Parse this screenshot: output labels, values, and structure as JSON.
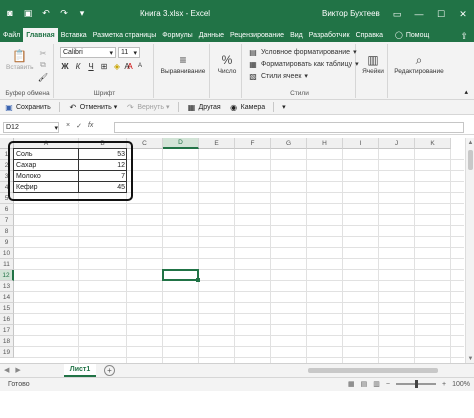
{
  "titlebar": {
    "title": "Книга 3.xlsx  -  Excel",
    "user": "Виктор Бухтеев"
  },
  "tabs": [
    {
      "label": "Файл",
      "active": false
    },
    {
      "label": "Главная",
      "active": true
    },
    {
      "label": "Вставка",
      "active": false
    },
    {
      "label": "Разметка страницы",
      "active": false
    },
    {
      "label": "Формулы",
      "active": false
    },
    {
      "label": "Данные",
      "active": false
    },
    {
      "label": "Рецензирование",
      "active": false
    },
    {
      "label": "Вид",
      "active": false
    },
    {
      "label": "Разработчик",
      "active": false
    },
    {
      "label": "Справка",
      "active": false
    }
  ],
  "search_tab": "Помощ",
  "ribbon": {
    "clipboard": {
      "paste": "Вставить",
      "label": "Буфер обмена"
    },
    "font": {
      "name": "Calibri",
      "size": "11",
      "label": "Шрифт"
    },
    "alignment": {
      "label": "Выравнивание"
    },
    "number": {
      "label": "Число"
    },
    "styles": {
      "conditional": "Условное форматирование",
      "as_table": "Форматировать как таблицу",
      "cell_styles": "Стили ячеек",
      "label": "Стили"
    },
    "cells": {
      "label": "Ячейки"
    },
    "editing": {
      "label": "Редактирование"
    }
  },
  "qat": {
    "save": "Сохранить",
    "undo": "Отменить",
    "redo": "Вернуть",
    "other": "Другая",
    "camera": "Камера"
  },
  "formula_bar": {
    "name_box": "D12",
    "cancel": "×",
    "enter": "✓",
    "fx": "fx",
    "value": ""
  },
  "columns": [
    "A",
    "B",
    "C",
    "D",
    "E",
    "F",
    "G",
    "H",
    "I",
    "J",
    "K"
  ],
  "selected_column": "D",
  "selected_row": "12",
  "rows": [
    "1",
    "2",
    "3",
    "4",
    "5",
    "6",
    "7",
    "8",
    "9",
    "10",
    "11",
    "12",
    "13",
    "14",
    "15",
    "16",
    "17",
    "18",
    "19"
  ],
  "table": [
    {
      "name": "Соль",
      "value": "53"
    },
    {
      "name": "Сахар",
      "value": "12"
    },
    {
      "name": "Молоко",
      "value": "7"
    },
    {
      "name": "Кефир",
      "value": "45"
    }
  ],
  "sheet": {
    "name": "Лист1",
    "add": "+"
  },
  "status": {
    "text": "Готово",
    "zoom": "100%"
  },
  "colors": {
    "accent": "#217346"
  }
}
